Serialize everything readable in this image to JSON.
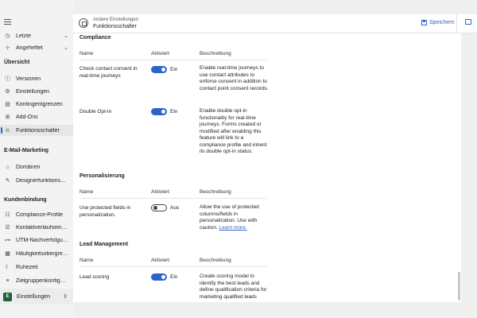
{
  "sidebar": {
    "recent": {
      "label": "Letzte"
    },
    "pinned": {
      "label": "Angeheftet"
    },
    "overview_heading": "Übersicht",
    "overview": [
      {
        "label": "Versionen"
      },
      {
        "label": "Einstellungen"
      },
      {
        "label": "Kontingentgrenzen"
      },
      {
        "label": "Add-Ons"
      },
      {
        "label": "Funktionsschalter"
      }
    ],
    "email_heading": "E-Mail-Marketing",
    "email": [
      {
        "label": "Domänen"
      },
      {
        "label": "Designerfunktionssc..."
      }
    ],
    "customer_heading": "Kundenbindung",
    "customer": [
      {
        "label": "Compliance-Profile"
      },
      {
        "label": "Kontaktverlaufseinst..."
      },
      {
        "label": "UTM-Nachverfolgung"
      },
      {
        "label": "Häufigkeitsobergrenze"
      },
      {
        "label": "Ruhezeit"
      },
      {
        "label": "Zielgruppenkonfigur..."
      }
    ],
    "area": {
      "badge": "E",
      "label": "Einstellungen"
    }
  },
  "header": {
    "subtitle": "Andere Einstellungen",
    "title": "Funktionsschalter",
    "save_label": "Speichern"
  },
  "sections": {
    "compliance": {
      "title": "Compliance",
      "col_name": "Name",
      "col_active": "Aktiviert",
      "col_desc": "Beschreibung",
      "rows": [
        {
          "name": "Check contact consent in real-time journeys",
          "state": "Ein",
          "desc": "Enable real-time journeys to use contact attributes to enforce consent in addition to contact point consent records."
        },
        {
          "name": "Double Opt-in",
          "state": "Ein",
          "desc": "Enable double opt-in functionality for real-time journeys. Forms created or modified after enabling this feature will link to a compliance profile and inherit its double opt-in status."
        }
      ]
    },
    "personalization": {
      "title": "Personalisierung",
      "col_name": "Name",
      "col_active": "Aktiviert",
      "col_desc": "Beschreibung",
      "rows": [
        {
          "name": "Use protected fields in personalization.",
          "state": "Aus",
          "desc": "Allow the use of protected columns/fields in personalization. Use with caution.",
          "link": "Learn more."
        }
      ]
    },
    "lead": {
      "title": "Lead Management",
      "col_name": "Name",
      "col_active": "Aktiviert",
      "col_desc": "Beschreibung",
      "rows": [
        {
          "name": "Lead scoring",
          "state": "Ein",
          "desc": "Create scoring model to identify the best leads and define qualification criteria for marketing qualified leads"
        }
      ]
    }
  },
  "colors": {
    "accent": "#2b63c9",
    "area_badge": "#1f5e3a"
  }
}
